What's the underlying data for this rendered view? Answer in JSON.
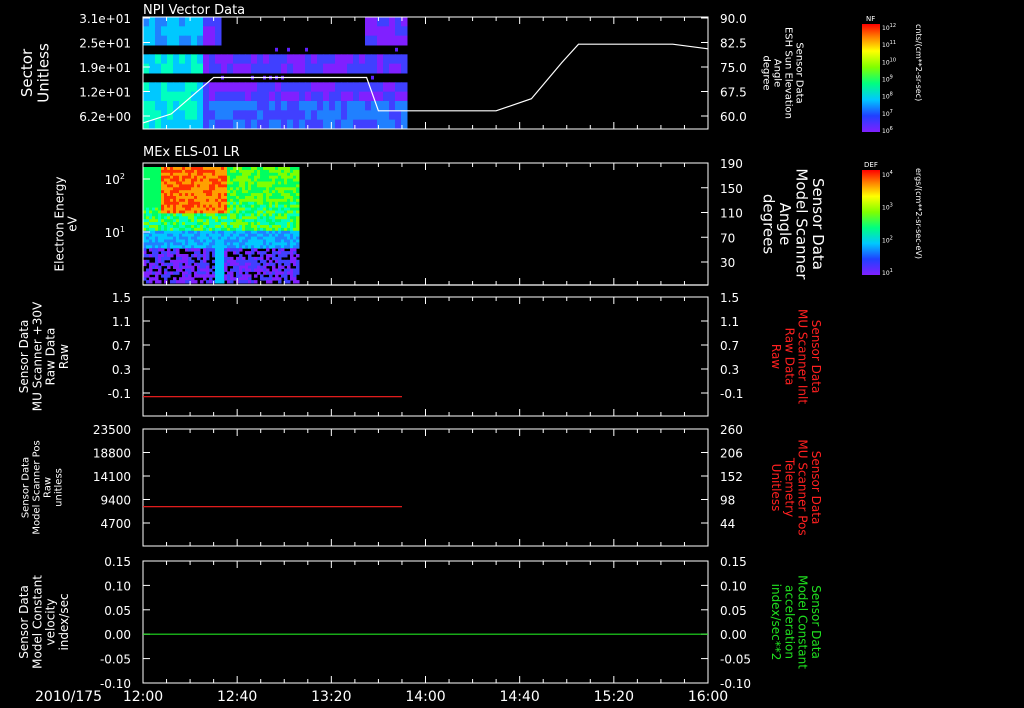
{
  "colors": {
    "background": "#000000",
    "axis": "#ffffff",
    "red_trace": "#ff2020",
    "green_trace": "#20e020"
  },
  "date_label": "2010/175",
  "time_axis": {
    "range": [
      "12:00",
      "16:00"
    ],
    "tick_labels": [
      "12:00",
      "12:40",
      "13:20",
      "14:00",
      "14:40",
      "15:20",
      "16:00"
    ]
  },
  "chart_data": [
    {
      "type": "heatmap",
      "title": "NPI Vector Data",
      "ylabel_left": [
        "Sector",
        "Unitless"
      ],
      "yticks_left": [
        "3.1e+01",
        "2.5e+01",
        "1.9e+01",
        "1.2e+01",
        "6.2e+00"
      ],
      "ylabel_right": [
        "Sensor Data",
        "ESH Sun Elevation",
        "Angle",
        "degree"
      ],
      "yticks_right": [
        "90.0",
        "82.5",
        "75.0",
        "67.5",
        "60.0"
      ],
      "ylim_right": [
        53,
        90
      ],
      "data_end_time": "13:50",
      "colorbar": {
        "label": "NF",
        "units": "cnts/(cm**2-sr-sec)",
        "tick_labels": [
          "10^12",
          "10^11",
          "10^10",
          "10^9",
          "10^8",
          "10^7",
          "10^6"
        ]
      },
      "overlay_line": {
        "name": "Sensor Data ESH Sun Elevation Angle",
        "x": [
          "12:00",
          "12:12",
          "12:24",
          "12:30",
          "13:35",
          "13:40",
          "14:30",
          "14:45",
          "14:58",
          "15:05",
          "15:45",
          "16:00"
        ],
        "y": [
          55,
          58,
          66,
          70,
          70,
          59,
          59,
          63,
          75,
          81,
          81,
          79.5
        ]
      }
    },
    {
      "type": "heatmap",
      "title": "MEx ELS-01 LR",
      "ylabel_left": [
        "Electron Energy",
        "eV"
      ],
      "yticks_left": [
        "10^2",
        "10^1"
      ],
      "ylabel_right": [
        "Sensor Data",
        "Model Scanner",
        "Angle",
        "degrees"
      ],
      "yticks_right": [
        "190",
        "150",
        "110",
        "70",
        "30"
      ],
      "ylim_right": [
        10,
        190
      ],
      "data_end_time": "13:05",
      "colorbar": {
        "label": "DEF",
        "units": "ergs/(cm**2-sr-sec-eV)",
        "tick_labels": [
          "10^4",
          "10^3",
          "10^2",
          "10^1"
        ]
      },
      "overlay_line": {
        "name": "Sensor Data Model Scanner Angle",
        "x": [
          "12:00",
          "16:00"
        ],
        "y": [
          10,
          10
        ]
      }
    },
    {
      "type": "line",
      "ylabel_left": [
        "Sensor Data",
        "MU Scanner +30V",
        "Raw Data",
        "Raw"
      ],
      "yticks_left": [
        "1.5",
        "1.1",
        "0.7",
        "0.3",
        "-0.1"
      ],
      "ylim_left": [
        -0.35,
        1.5
      ],
      "ylabel_right": [
        "Sensor Data",
        "MU Scanner Inlt",
        "Raw Data",
        "Raw"
      ],
      "yticks_right": [
        "1.5",
        "1.1",
        "0.7",
        "0.3",
        "-0.1"
      ],
      "series": [
        {
          "name": "Sensor Data MU Scanner +30V Raw Data",
          "color": "#ff2020",
          "x": [
            "12:00",
            "13:50"
          ],
          "y": [
            -0.05,
            -0.05
          ]
        }
      ]
    },
    {
      "type": "line",
      "ylabel_left": [
        "Sensor Data",
        "Model Scanner Pos",
        "Raw",
        "unitless"
      ],
      "yticks_left": [
        "23500",
        "18800",
        "14100",
        "9400",
        "4700"
      ],
      "ylim_left": [
        0,
        23500
      ],
      "ylabel_right": [
        "Sensor Data",
        "MU Scanner Pos",
        "Telemetry",
        "Unitless"
      ],
      "yticks_right": [
        "260",
        "206",
        "152",
        "98",
        "44"
      ],
      "series": [
        {
          "name": "Sensor Data Model Scanner Pos Raw",
          "color": "#ff2020",
          "x": [
            "12:00",
            "13:50"
          ],
          "y": [
            7900,
            7900
          ]
        }
      ]
    },
    {
      "type": "line",
      "ylabel_left": [
        "Sensor Data",
        "Model Constant",
        "velocity",
        "index/sec"
      ],
      "yticks_left": [
        "0.15",
        "0.10",
        "0.05",
        "0.00",
        "-0.05",
        "-0.10"
      ],
      "ylim_left": [
        -0.1,
        0.15
      ],
      "ylabel_right": [
        "Sensor Data",
        "Model Constant",
        "acceleration",
        "index/sec**2"
      ],
      "yticks_right": [
        "0.15",
        "0.10",
        "0.05",
        "0.00",
        "-0.05",
        "-0.10"
      ],
      "series": [
        {
          "name": "Sensor Data Model Constant velocity",
          "color": "#20e020",
          "x": [
            "12:00",
            "16:00"
          ],
          "y": [
            0,
            0
          ]
        }
      ]
    }
  ]
}
